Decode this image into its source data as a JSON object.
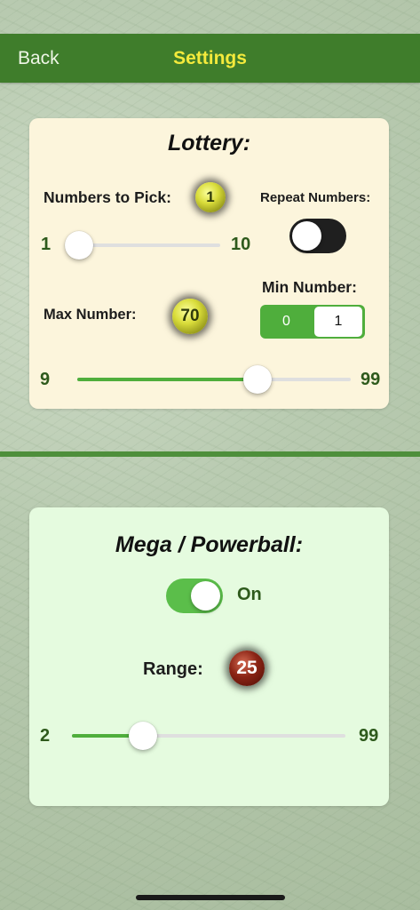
{
  "nav": {
    "back_label": "Back",
    "title": "Settings"
  },
  "lottery": {
    "title": "Lottery:",
    "numbers_to_pick_label": "Numbers to Pick:",
    "numbers_to_pick_value": "1",
    "pick_slider": {
      "min_label": "1",
      "max_label": "10",
      "value": 1,
      "min": 1,
      "max": 10
    },
    "repeat_numbers_label": "Repeat Numbers:",
    "repeat_numbers_on": false,
    "min_number_label": "Min Number:",
    "min_number_options": [
      "0",
      "1"
    ],
    "min_number_selected": "1",
    "max_number_label": "Max Number:",
    "max_number_value": "70",
    "max_slider": {
      "min_label": "9",
      "max_label": "99",
      "value": 70,
      "min": 9,
      "max": 99
    }
  },
  "mega": {
    "title": "Mega / Powerball:",
    "toggle_on": true,
    "toggle_label": "On",
    "range_label": "Range:",
    "range_value": "25",
    "range_slider": {
      "min_label": "2",
      "max_label": "99",
      "value": 25,
      "min": 2,
      "max": 99
    }
  },
  "colors": {
    "nav_background": "#3f7d2b",
    "nav_title": "#f4ea3c",
    "accent_green": "#4fae3c",
    "lottery_card": "#fcf5dc",
    "mega_card": "#e5fbdf"
  }
}
